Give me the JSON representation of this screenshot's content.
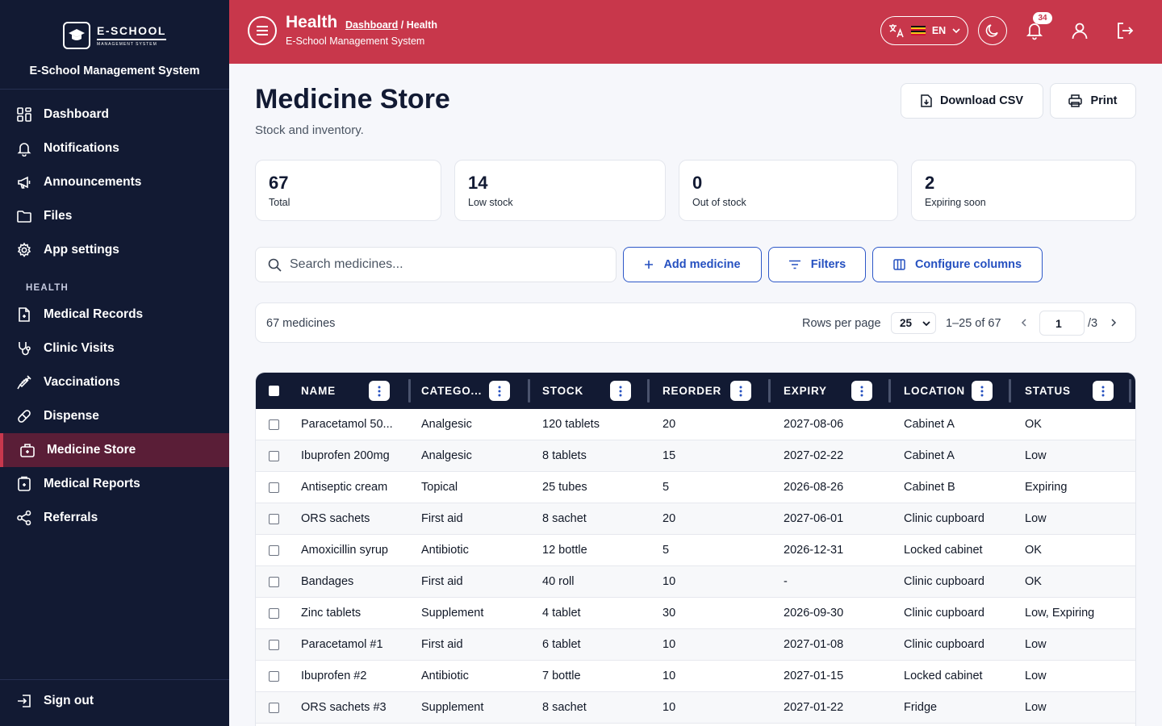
{
  "sidebar": {
    "logo_main": "E-SCHOOL",
    "logo_sub": "MANAGEMENT SYSTEM",
    "brand_title": "E-School Management System",
    "items": [
      {
        "label": "Dashboard",
        "icon": "dashboard-icon"
      },
      {
        "label": "Notifications",
        "icon": "bell-icon"
      },
      {
        "label": "Announcements",
        "icon": "megaphone-icon"
      },
      {
        "label": "Files",
        "icon": "folder-icon"
      },
      {
        "label": "App settings",
        "icon": "gear-icon"
      }
    ],
    "section_label": "HEALTH",
    "health_items": [
      {
        "label": "Medical Records",
        "icon": "medical-record-icon"
      },
      {
        "label": "Clinic Visits",
        "icon": "stethoscope-icon"
      },
      {
        "label": "Vaccinations",
        "icon": "syringe-icon"
      },
      {
        "label": "Dispense",
        "icon": "pill-icon"
      },
      {
        "label": "Medicine Store",
        "icon": "medkit-icon",
        "active": true
      },
      {
        "label": "Medical Reports",
        "icon": "report-icon"
      },
      {
        "label": "Referrals",
        "icon": "share-icon"
      }
    ],
    "sign_out": "Sign out"
  },
  "header": {
    "title": "Health",
    "breadcrumb_link": "Dashboard",
    "breadcrumb_sep": "/",
    "breadcrumb_current": "Health",
    "subtitle": "E-School Management System",
    "language": "EN",
    "notification_count": "34",
    "accent": "#c8374b"
  },
  "page": {
    "title": "Medicine Store",
    "subtitle": "Stock and inventory.",
    "download_csv": "Download CSV",
    "print": "Print"
  },
  "stats": [
    {
      "value": "67",
      "label": "Total"
    },
    {
      "value": "14",
      "label": "Low stock"
    },
    {
      "value": "0",
      "label": "Out of stock"
    },
    {
      "value": "2",
      "label": "Expiring soon"
    }
  ],
  "toolbar": {
    "search_placeholder": "Search medicines...",
    "add": "Add medicine",
    "filters": "Filters",
    "columns": "Configure columns"
  },
  "pager": {
    "count": "67 medicines",
    "rows_per_page_label": "Rows per page",
    "rows_per_page": "25",
    "range": "1–25 of 67",
    "page": "1",
    "total_pages": "/3"
  },
  "table": {
    "columns": [
      "NAME",
      "CATEGO...",
      "STOCK",
      "REORDER",
      "EXPIRY",
      "LOCATION",
      "STATUS"
    ],
    "rows": [
      [
        "Paracetamol 50...",
        "Analgesic",
        "120 tablets",
        "20",
        "2027-08-06",
        "Cabinet A",
        "OK"
      ],
      [
        "Ibuprofen 200mg",
        "Analgesic",
        "8 tablets",
        "15",
        "2027-02-22",
        "Cabinet A",
        "Low"
      ],
      [
        "Antiseptic cream",
        "Topical",
        "25 tubes",
        "5",
        "2026-08-26",
        "Cabinet B",
        "Expiring"
      ],
      [
        "ORS sachets",
        "First aid",
        "8 sachet",
        "20",
        "2027-06-01",
        "Clinic cupboard",
        "Low"
      ],
      [
        "Amoxicillin syrup",
        "Antibiotic",
        "12 bottle",
        "5",
        "2026-12-31",
        "Locked cabinet",
        "OK"
      ],
      [
        "Bandages",
        "First aid",
        "40 roll",
        "10",
        "-",
        "Clinic cupboard",
        "OK"
      ],
      [
        "Zinc tablets",
        "Supplement",
        "4 tablet",
        "30",
        "2026-09-30",
        "Clinic cupboard",
        "Low, Expiring"
      ],
      [
        "Paracetamol #1",
        "First aid",
        "6 tablet",
        "10",
        "2027-01-08",
        "Clinic cupboard",
        "Low"
      ],
      [
        "Ibuprofen #2",
        "Antibiotic",
        "7 bottle",
        "10",
        "2027-01-15",
        "Locked cabinet",
        "Low"
      ],
      [
        "ORS sachets #3",
        "Supplement",
        "8 sachet",
        "10",
        "2027-01-22",
        "Fridge",
        "Low"
      ]
    ]
  }
}
